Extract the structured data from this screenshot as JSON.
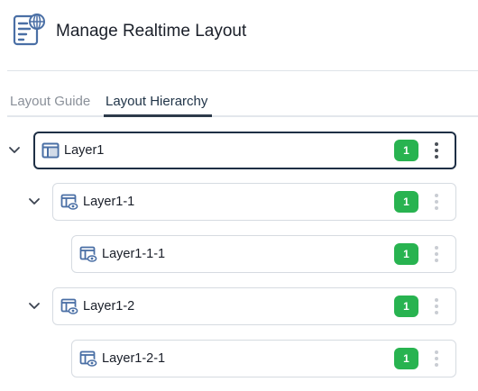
{
  "header": {
    "title": "Manage Realtime Layout",
    "icon": "layout-settings-icon"
  },
  "tabs": [
    {
      "label": "Layout Guide",
      "active": false
    },
    {
      "label": "Layout Hierarchy",
      "active": true
    }
  ],
  "tree": {
    "nodes": [
      {
        "label": "Layer1",
        "badge": "1",
        "depth": 0,
        "expanded": true,
        "selected": true,
        "icon": "layer-panel-icon"
      },
      {
        "label": "Layer1-1",
        "badge": "1",
        "depth": 1,
        "expanded": true,
        "selected": false,
        "icon": "layer-view-icon"
      },
      {
        "label": "Layer1-1-1",
        "badge": "1",
        "depth": 2,
        "expanded": false,
        "selected": false,
        "icon": "layer-view-icon"
      },
      {
        "label": "Layer1-2",
        "badge": "1",
        "depth": 1,
        "expanded": true,
        "selected": false,
        "icon": "layer-view-icon"
      },
      {
        "label": "Layer1-2-1",
        "badge": "1",
        "depth": 2,
        "expanded": false,
        "selected": false,
        "icon": "layer-view-icon"
      }
    ]
  },
  "colors": {
    "badge": "#28b350",
    "selected_border": "#1e2f45",
    "icon_blue": "#4a6fa5",
    "kebab_active": "#4a4f57",
    "kebab_muted": "#c9cdd3"
  }
}
